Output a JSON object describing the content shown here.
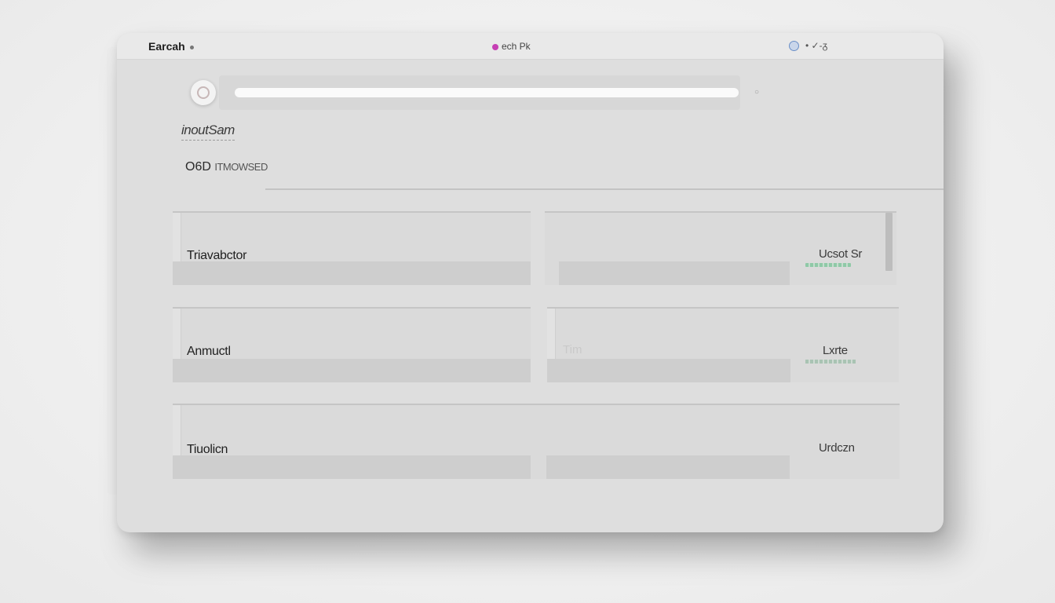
{
  "titlebar": {
    "app_title": "Earcah",
    "center_title": "ech Pk",
    "controls_text": "• ✓-ᵹ"
  },
  "search": {
    "value": "",
    "placeholder": ""
  },
  "subtitle": "inoutSam",
  "section": {
    "label_main": "O6D",
    "label_faint": "ITMOWSED"
  },
  "rows": [
    {
      "label": "Triavabctor",
      "value": "Ucsot Sr"
    },
    {
      "label": "Anmuctl",
      "value": "Lxrte",
      "ghost": "Tim"
    },
    {
      "label": "Tiuolicn",
      "value": "Urdczn"
    }
  ],
  "colors": {
    "accent_pink": "#c63fb4",
    "accent_green": "#8fc9a7",
    "window_bg": "#dedede"
  }
}
